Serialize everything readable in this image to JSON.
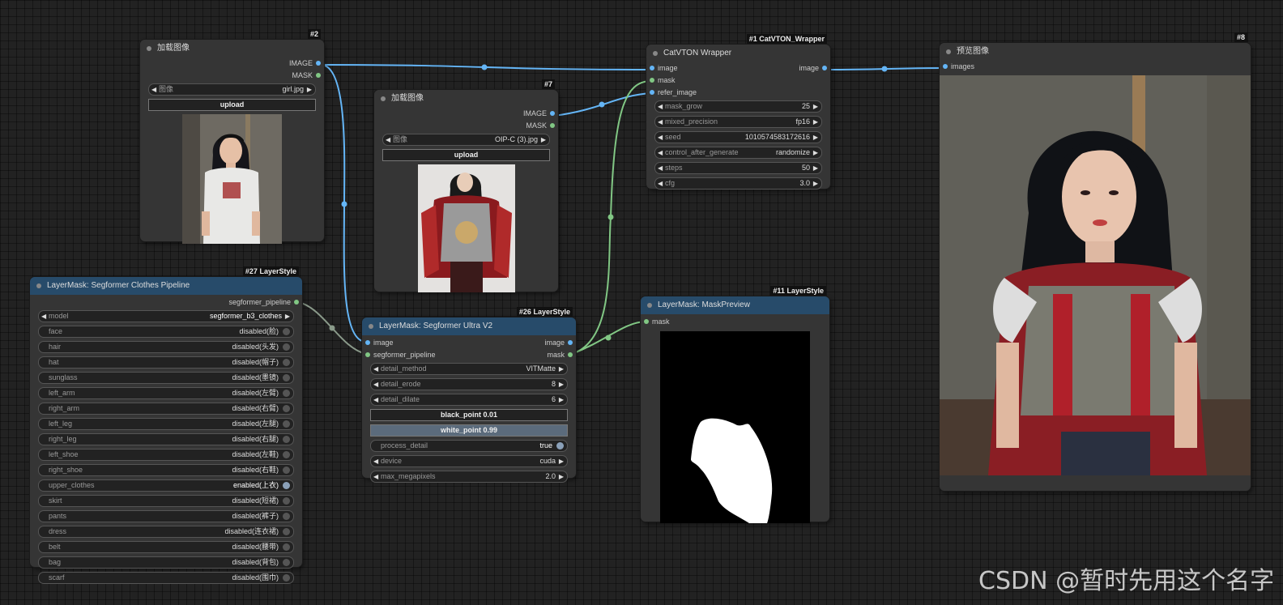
{
  "colors": {
    "image_link": "#64b5f6",
    "mask_link": "#81c784",
    "canvas": "#222222",
    "node": "#353535",
    "node_header_blue": "#274b6a"
  },
  "nodes": {
    "load1": {
      "id": "#2",
      "title": "加载图像",
      "outputs": [
        "IMAGE",
        "MASK"
      ],
      "image_widget": {
        "label": "图像",
        "value": "girl.jpg"
      },
      "upload": "upload",
      "preview": "girl in white t-shirt photo"
    },
    "load2": {
      "id": "#7",
      "title": "加载图像",
      "outputs": [
        "IMAGE",
        "MASK"
      ],
      "image_widget": {
        "label": "图像",
        "value": "OIP-C (3).jpg"
      },
      "upload": "upload",
      "preview": "person in red armor photo"
    },
    "catvton": {
      "id": "#1",
      "tag": "CatVTON_Wrapper",
      "title": "CatVTON Wrapper",
      "inputs": [
        "image",
        "mask",
        "refer_image"
      ],
      "output": "image",
      "widgets": [
        {
          "label": "mask_grow",
          "value": "25"
        },
        {
          "label": "mixed_precision",
          "value": "fp16"
        },
        {
          "label": "seed",
          "value": "1010574583172616"
        },
        {
          "label": "control_after_generate",
          "value": "randomize"
        },
        {
          "label": "steps",
          "value": "50"
        },
        {
          "label": "cfg",
          "value": "3.0"
        }
      ]
    },
    "preview": {
      "id": "#8",
      "title": "预览图像",
      "input": "images",
      "preview": "girl in red armor top photo"
    },
    "clothes": {
      "id": "#27",
      "tag": "LayerStyle",
      "title": "LayerMask: Segformer Clothes Pipeline",
      "output": "segformer_pipeline",
      "model": {
        "label": "model",
        "value": "segformer_b3_clothes"
      },
      "toggles": [
        {
          "label": "face",
          "value": "disabled(脸)",
          "on": false
        },
        {
          "label": "hair",
          "value": "disabled(头发)",
          "on": false
        },
        {
          "label": "hat",
          "value": "disabled(帽子)",
          "on": false
        },
        {
          "label": "sunglass",
          "value": "disabled(墨镜)",
          "on": false
        },
        {
          "label": "left_arm",
          "value": "disabled(左臂)",
          "on": false
        },
        {
          "label": "right_arm",
          "value": "disabled(右臂)",
          "on": false
        },
        {
          "label": "left_leg",
          "value": "disabled(左腿)",
          "on": false
        },
        {
          "label": "right_leg",
          "value": "disabled(右腿)",
          "on": false
        },
        {
          "label": "left_shoe",
          "value": "disabled(左鞋)",
          "on": false
        },
        {
          "label": "right_shoe",
          "value": "disabled(右鞋)",
          "on": false
        },
        {
          "label": "upper_clothes",
          "value": "enabled(上衣)",
          "on": true
        },
        {
          "label": "skirt",
          "value": "disabled(短裙)",
          "on": false
        },
        {
          "label": "pants",
          "value": "disabled(裤子)",
          "on": false
        },
        {
          "label": "dress",
          "value": "disabled(连衣裙)",
          "on": false
        },
        {
          "label": "belt",
          "value": "disabled(腰带)",
          "on": false
        },
        {
          "label": "bag",
          "value": "disabled(背包)",
          "on": false
        },
        {
          "label": "scarf",
          "value": "disabled(围巾)",
          "on": false
        }
      ]
    },
    "ultra": {
      "id": "#26",
      "tag": "LayerStyle",
      "title": "LayerMask: Segformer Ultra V2",
      "inputs": [
        "image",
        "segformer_pipeline"
      ],
      "outputs": [
        "image",
        "mask"
      ],
      "widgets": [
        {
          "label": "detail_method",
          "value": "VITMatte"
        },
        {
          "label": "detail_erode",
          "value": "8"
        },
        {
          "label": "detail_dilate",
          "value": "6"
        }
      ],
      "black_point": "black_point  0.01",
      "white_point": "white_point  0.99",
      "process_detail": {
        "label": "process_detail",
        "value": "true"
      },
      "widgets2": [
        {
          "label": "device",
          "value": "cuda"
        },
        {
          "label": "max_megapixels",
          "value": "2.0"
        }
      ]
    },
    "maskprev": {
      "id": "#11",
      "tag": "LayerStyle",
      "title": "LayerMask: MaskPreview",
      "input": "mask",
      "preview": "white torso mask on black"
    }
  },
  "watermark": "CSDN @暂时先用这个名字"
}
